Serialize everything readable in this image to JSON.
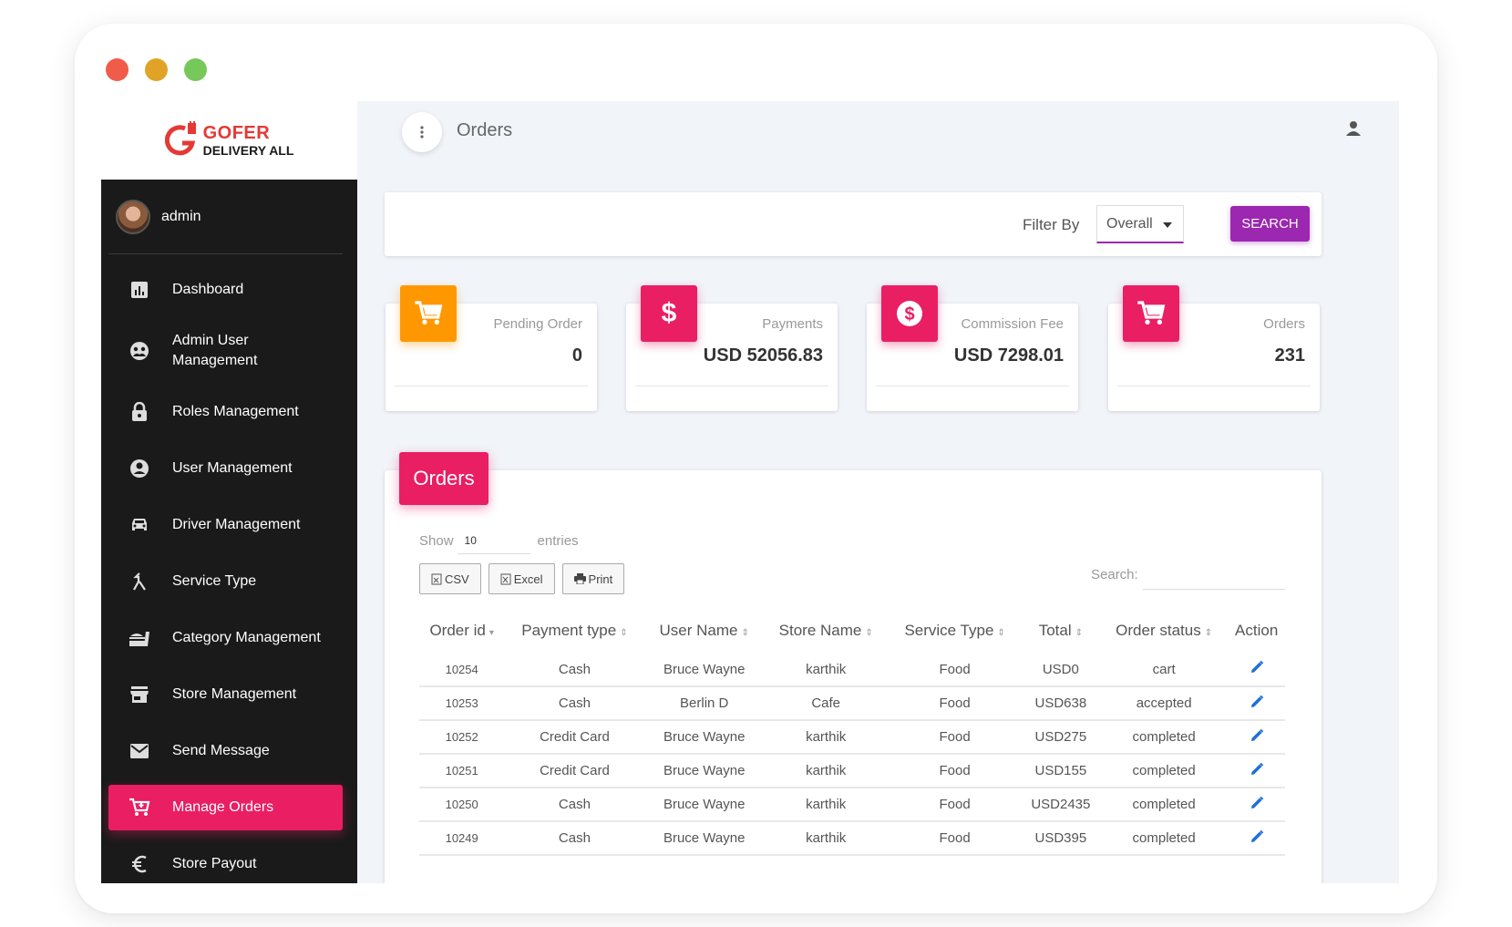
{
  "brand": {
    "line1": "GOFER",
    "line2": "DELIVERY ALL"
  },
  "user": {
    "name": "admin"
  },
  "sidebar": {
    "items": [
      {
        "label": "Dashboard",
        "icon": "dashboard-icon"
      },
      {
        "label": "Admin User Management",
        "icon": "admin-user-icon"
      },
      {
        "label": "Roles Management",
        "icon": "lock-icon"
      },
      {
        "label": "User Management",
        "icon": "account-circle-icon"
      },
      {
        "label": "Driver Management",
        "icon": "car-icon"
      },
      {
        "label": "Service Type",
        "icon": "merge-icon"
      },
      {
        "label": "Category Management",
        "icon": "food-icon"
      },
      {
        "label": "Store Management",
        "icon": "store-icon"
      },
      {
        "label": "Send Message",
        "icon": "mail-icon"
      },
      {
        "label": "Manage Orders",
        "icon": "cart-icon",
        "active": true
      },
      {
        "label": "Store Payout",
        "icon": "euro-icon"
      }
    ]
  },
  "header": {
    "title": "Orders"
  },
  "filter": {
    "label": "Filter By",
    "value": "Overall",
    "button": "SEARCH"
  },
  "stats": [
    {
      "label": "Pending Order",
      "value": "0",
      "icon": "cart-icon",
      "color": "#ff9800"
    },
    {
      "label": "Payments",
      "value": "USD 52056.83",
      "icon": "dollar-icon",
      "color": "#e91e63"
    },
    {
      "label": "Commission Fee",
      "value": "USD 7298.01",
      "icon": "dollar-circle-icon",
      "color": "#e91e63"
    },
    {
      "label": "Orders",
      "value": "231",
      "icon": "cart-icon",
      "color": "#e91e63"
    }
  ],
  "orders": {
    "title": "Orders",
    "show_label": "Show",
    "show_value": "10",
    "entries_label": "entries",
    "buttons": {
      "csv": "CSV",
      "excel": "Excel",
      "print": "Print"
    },
    "search_label": "Search:",
    "columns": [
      "Order id",
      "Payment type",
      "User Name",
      "Store Name",
      "Service Type",
      "Total",
      "Order status",
      "Action"
    ],
    "rows": [
      [
        "10254",
        "Cash",
        "Bruce Wayne",
        "karthik",
        "Food",
        "USD0",
        "cart"
      ],
      [
        "10253",
        "Cash",
        "Berlin D",
        "Cafe",
        "Food",
        "USD638",
        "accepted"
      ],
      [
        "10252",
        "Credit Card",
        "Bruce Wayne",
        "karthik",
        "Food",
        "USD275",
        "completed"
      ],
      [
        "10251",
        "Credit Card",
        "Bruce Wayne",
        "karthik",
        "Food",
        "USD155",
        "completed"
      ],
      [
        "10250",
        "Cash",
        "Bruce Wayne",
        "karthik",
        "Food",
        "USD2435",
        "completed"
      ],
      [
        "10249",
        "Cash",
        "Bruce Wayne",
        "karthik",
        "Food",
        "USD395",
        "completed"
      ]
    ]
  },
  "colors": {
    "accent": "#e91e63",
    "purple": "#9c27b0",
    "orange": "#ff9800",
    "sidebar": "#1a1a1a",
    "edit": "#1e6fd9"
  }
}
